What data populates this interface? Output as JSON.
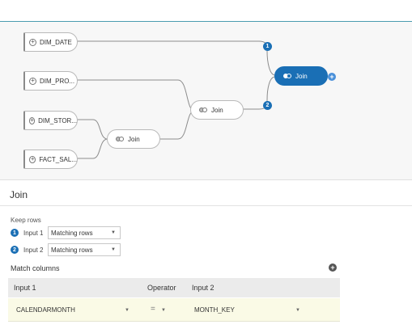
{
  "canvas": {
    "sources": [
      {
        "label": "DIM_DATE"
      },
      {
        "label": "DIM_PRO..."
      },
      {
        "label": "DIM_STOR..."
      },
      {
        "label": "FACT_SAL..."
      }
    ],
    "joins": [
      {
        "label": "Join"
      },
      {
        "label": "Join"
      },
      {
        "label": "Join"
      }
    ],
    "badges": [
      "1",
      "2"
    ],
    "add_symbol": "+"
  },
  "panel": {
    "title": "Join",
    "keep_rows_label": "Keep rows",
    "inputs": [
      {
        "num": "1",
        "label": "Input 1",
        "value": "Matching rows"
      },
      {
        "num": "2",
        "label": "Input 2",
        "value": "Matching rows"
      }
    ],
    "match_columns_label": "Match columns",
    "table": {
      "headers": [
        "Input 1",
        "Operator",
        "Input 2"
      ],
      "rows": [
        {
          "input1": "CALENDARMONTH",
          "operator": "=",
          "input2": "MONTH_KEY"
        }
      ]
    }
  },
  "colors": {
    "accent": "#1a6fb5",
    "topbar_line": "#4a9bb0"
  }
}
